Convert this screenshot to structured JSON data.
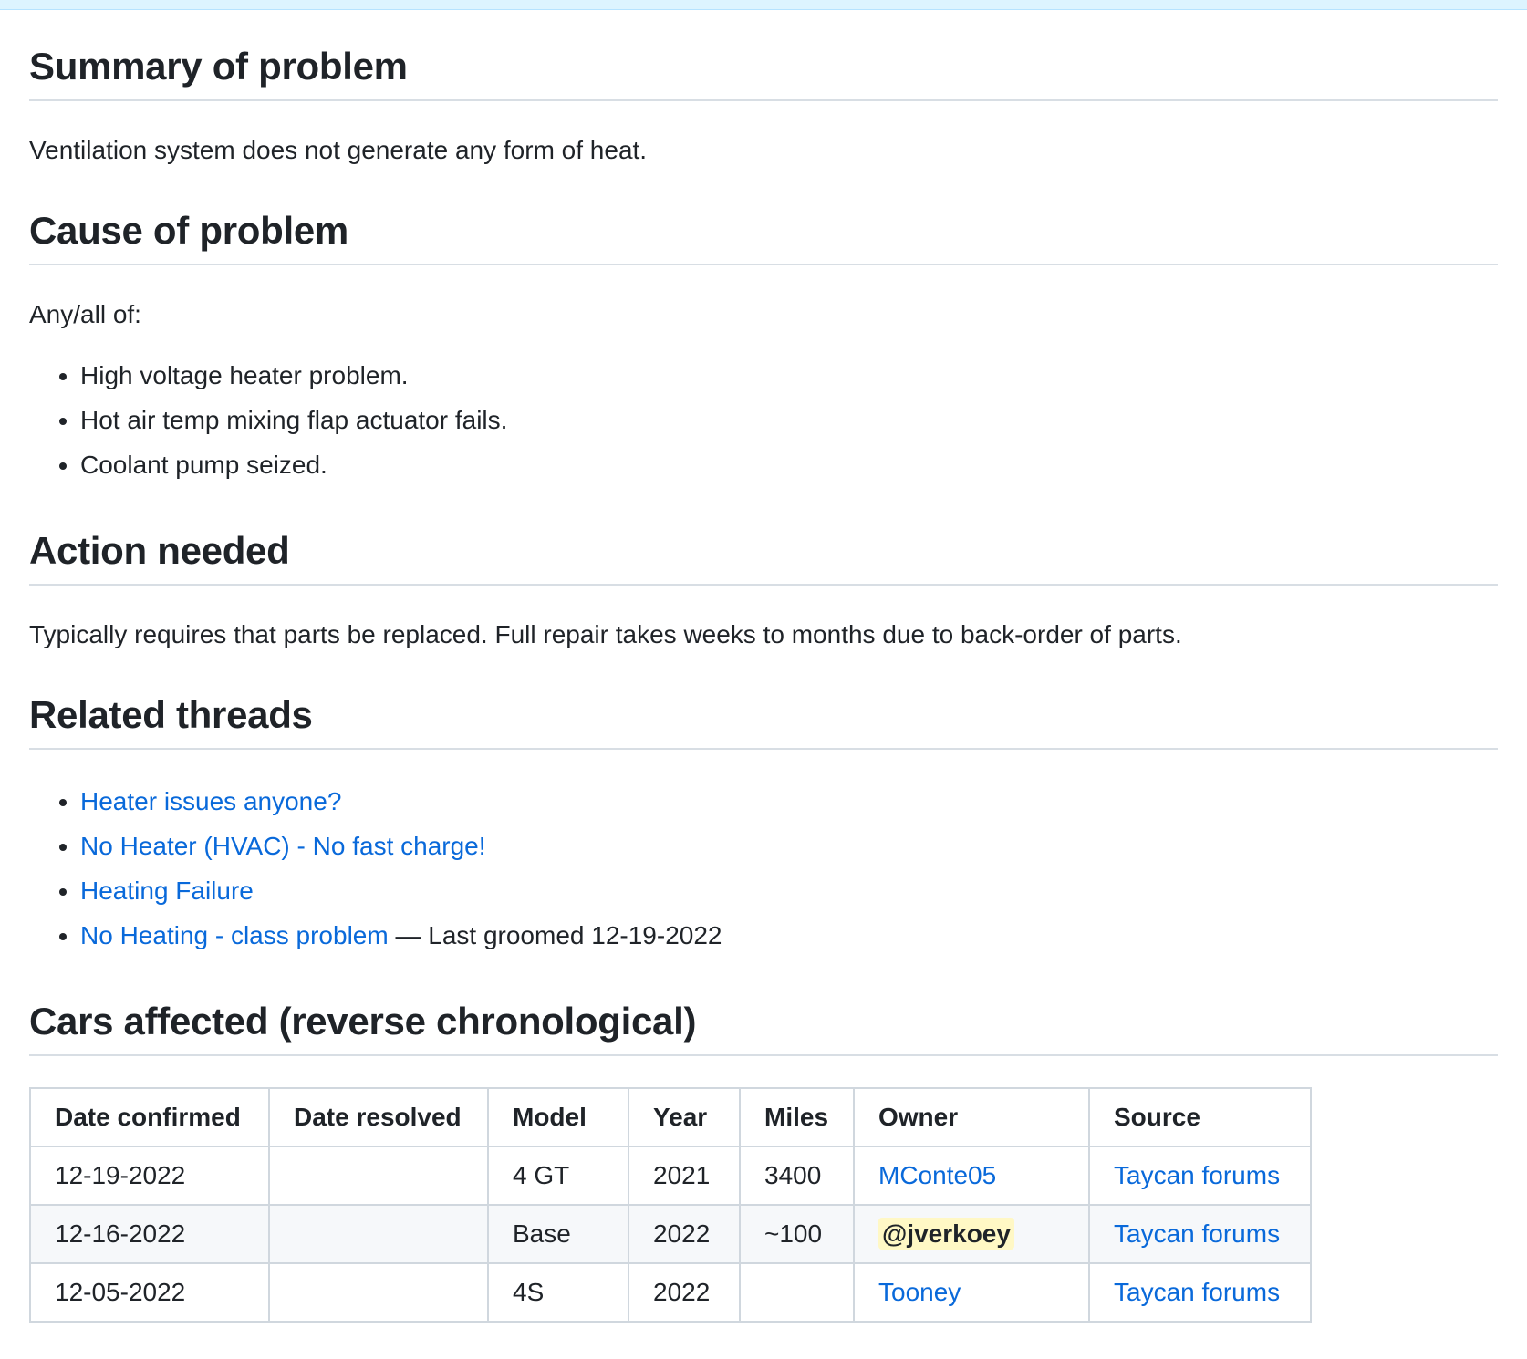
{
  "sections": {
    "summary": {
      "title": "Summary of problem",
      "text": "Ventilation system does not generate any form of heat."
    },
    "cause": {
      "title": "Cause of problem",
      "intro": "Any/all of:",
      "items": [
        "High voltage heater problem.",
        "Hot air temp mixing flap actuator fails.",
        "Coolant pump seized."
      ]
    },
    "action": {
      "title": "Action needed",
      "text": "Typically requires that parts be replaced. Full repair takes weeks to months due to back-order of parts."
    },
    "threads": {
      "title": "Related threads",
      "links": [
        "Heater issues anyone?",
        "No Heater (HVAC) - No fast charge!",
        "Heating Failure",
        "No Heating - class problem"
      ],
      "last_note": " — Last groomed 12-19-2022"
    },
    "cars": {
      "title": "Cars affected (reverse chronological)",
      "headers": [
        "Date confirmed",
        "Date resolved",
        "Model",
        "Year",
        "Miles",
        "Owner",
        "Source"
      ],
      "rows": [
        {
          "date_confirmed": "12-19-2022",
          "date_resolved": "",
          "model": "4 GT",
          "year": "2021",
          "miles": "3400",
          "owner": "MConte05",
          "source": "Taycan forums"
        },
        {
          "date_confirmed": "12-16-2022",
          "date_resolved": "",
          "model": "Base",
          "year": "2022",
          "miles": "~100",
          "owner": "@jverkoey",
          "source": "Taycan forums"
        },
        {
          "date_confirmed": "12-05-2022",
          "date_resolved": "",
          "model": "4S",
          "year": "2022",
          "miles": "",
          "owner": "Tooney",
          "source": "Taycan forums"
        }
      ]
    }
  },
  "colors": {
    "link": "#0969da",
    "mention_bg": "#fff8c5",
    "border": "#d0d7de"
  }
}
